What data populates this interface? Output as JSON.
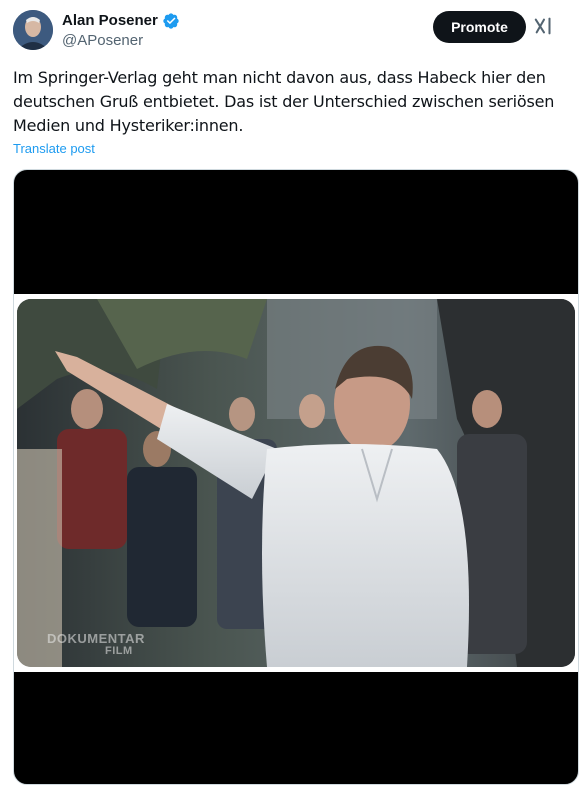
{
  "author": {
    "display_name": "Alan Posener",
    "handle": "@APosener",
    "verified": true,
    "verified_color": "#1d9bf0"
  },
  "header": {
    "promote_label": "Promote",
    "grok_icon": "grok-icon"
  },
  "post": {
    "text": "Im Springer-Verlag geht man nicht davon aus, dass Habeck hier den deutschen Gruß entbietet. Das ist der Unterschied zwischen seriösen Medien und Hysteriker:innen.",
    "translate_label": "Translate post"
  },
  "media": {
    "watermark_line1": "DOKUMENTAR",
    "watermark_line2": "FILM"
  },
  "colors": {
    "accent": "#1d9bf0",
    "button_bg": "#0f1419",
    "secondary_text": "#536471"
  }
}
